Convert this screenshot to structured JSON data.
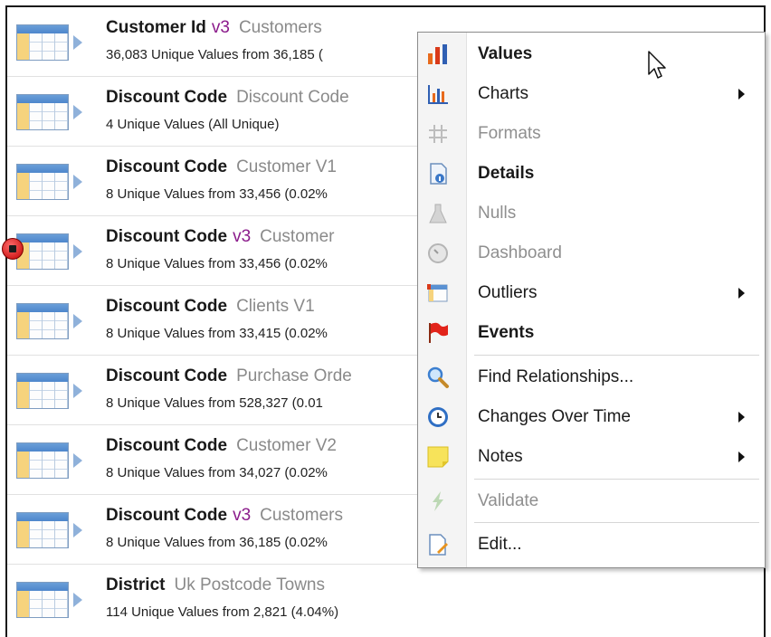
{
  "rows": [
    {
      "name": "Customer Id",
      "version": "v3",
      "table": "Customers",
      "summary": "36,083 Unique Values from 36,185 ("
    },
    {
      "name": "Discount Code",
      "version": "",
      "table": "Discount Code",
      "summary": "4 Unique Values (All Unique)"
    },
    {
      "name": "Discount Code",
      "version": "",
      "table": "Customer V1",
      "summary": "8 Unique Values from 33,456 (0.02%"
    },
    {
      "name": "Discount Code",
      "version": "v3",
      "table": "Customer",
      "summary": "8 Unique Values from 33,456 (0.02%"
    },
    {
      "name": "Discount Code",
      "version": "",
      "table": "Clients V1",
      "summary": "8 Unique Values from 33,415 (0.02%"
    },
    {
      "name": "Discount Code",
      "version": "",
      "table": "Purchase Orde",
      "summary": "8 Unique Values from 528,327 (0.01"
    },
    {
      "name": "Discount Code",
      "version": "",
      "table": "Customer V2",
      "summary": "8 Unique Values from 34,027 (0.02%"
    },
    {
      "name": "Discount Code",
      "version": "v3",
      "table": "Customers",
      "summary": "8 Unique Values from 36,185 (0.02%"
    },
    {
      "name": "District",
      "version": "",
      "table": "Uk Postcode Towns",
      "summary": "114 Unique Values from 2,821 (4.04%)"
    }
  ],
  "menu": {
    "items": [
      {
        "label": "Values",
        "icon": "bar-chart-icon",
        "bold": true,
        "disabled": false,
        "submenu": false
      },
      {
        "label": "Charts",
        "icon": "charts-icon",
        "bold": false,
        "disabled": false,
        "submenu": true
      },
      {
        "label": "Formats",
        "icon": "hash-icon",
        "bold": false,
        "disabled": true,
        "submenu": false
      },
      {
        "label": "Details",
        "icon": "details-icon",
        "bold": true,
        "disabled": false,
        "submenu": false
      },
      {
        "label": "Nulls",
        "icon": "flask-icon",
        "bold": false,
        "disabled": true,
        "submenu": false
      },
      {
        "label": "Dashboard",
        "icon": "gauge-icon",
        "bold": false,
        "disabled": true,
        "submenu": false
      },
      {
        "label": "Outliers",
        "icon": "outliers-icon",
        "bold": false,
        "disabled": false,
        "submenu": true
      },
      {
        "label": "Events",
        "icon": "flag-icon",
        "bold": true,
        "disabled": false,
        "submenu": false
      },
      {
        "label": "Find Relationships...",
        "icon": "magnifier-icon",
        "bold": false,
        "disabled": false,
        "submenu": false
      },
      {
        "label": "Changes Over Time",
        "icon": "clock-icon",
        "bold": false,
        "disabled": false,
        "submenu": true
      },
      {
        "label": "Notes",
        "icon": "sticky-note-icon",
        "bold": false,
        "disabled": false,
        "submenu": true
      },
      {
        "label": "Validate",
        "icon": "lightning-icon",
        "bold": false,
        "disabled": true,
        "submenu": false
      },
      {
        "label": "Edit...",
        "icon": "edit-document-icon",
        "bold": false,
        "disabled": false,
        "submenu": false
      }
    ]
  },
  "colors": {
    "version": "#8b1b8b",
    "table_name": "#8a8a8a",
    "disabled": "#8f8f8f"
  }
}
